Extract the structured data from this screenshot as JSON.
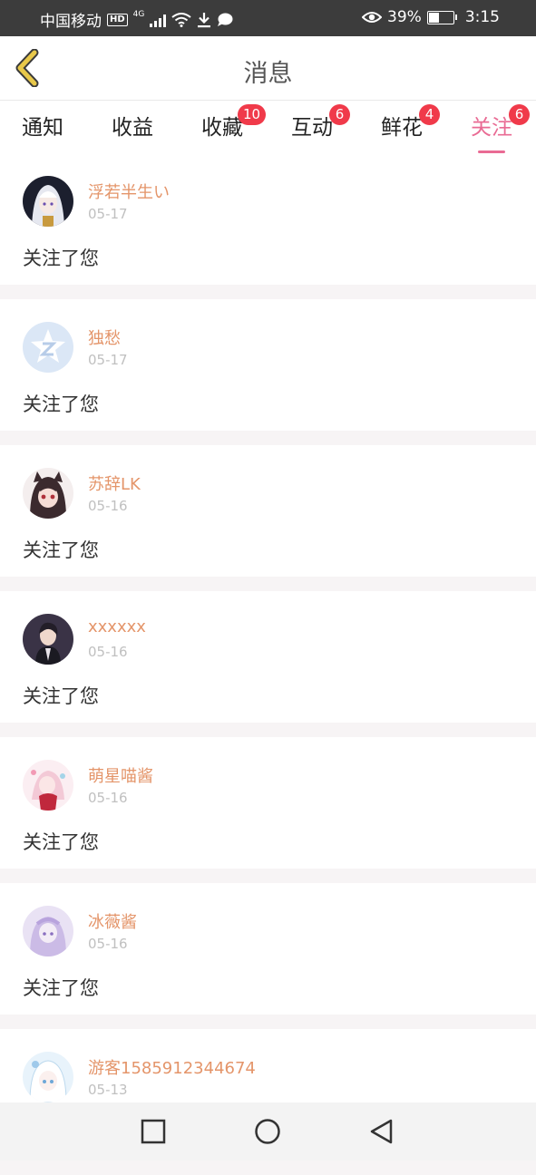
{
  "status_bar": {
    "carrier": "中国移动",
    "hd": "HD",
    "network": "4G",
    "battery": "39%",
    "battery_level": 0.39,
    "time": "3:15",
    "icons": [
      "signal-icon",
      "wifi-icon",
      "download-icon",
      "chat-bubble-icon",
      "eye-icon",
      "battery-icon"
    ]
  },
  "header": {
    "title": "消息",
    "back_icon": "chevron-left-icon"
  },
  "tabs": [
    {
      "label": "通知",
      "badge": "",
      "active": false
    },
    {
      "label": "收益",
      "badge": "",
      "active": false
    },
    {
      "label": "收藏",
      "badge": "10",
      "active": false
    },
    {
      "label": "互动",
      "badge": "6",
      "active": false
    },
    {
      "label": "鲜花",
      "badge": "4",
      "active": false
    },
    {
      "label": "关注",
      "badge": "6",
      "active": true
    }
  ],
  "messages": [
    {
      "name": "浮若半生い",
      "date": "05-17",
      "text": "关注了您"
    },
    {
      "name": "独愁",
      "date": "05-17",
      "text": "关注了您"
    },
    {
      "name": "苏辞LK",
      "date": "05-16",
      "text": "关注了您"
    },
    {
      "name": "xxxxxx",
      "date": "05-16",
      "text": "关注了您"
    },
    {
      "name": "萌星喵酱",
      "date": "05-16",
      "text": "关注了您"
    },
    {
      "name": "冰薇酱",
      "date": "05-16",
      "text": "关注了您"
    },
    {
      "name": "游客1585912344674",
      "date": "05-13",
      "text": ""
    }
  ],
  "colors": {
    "accent": "#e96b94",
    "badge": "#f03a4a",
    "username": "#e4956a",
    "back_icon": "#e8c84a"
  },
  "navbar": {
    "icons": [
      "recent-apps-icon",
      "home-icon",
      "back-icon"
    ]
  }
}
